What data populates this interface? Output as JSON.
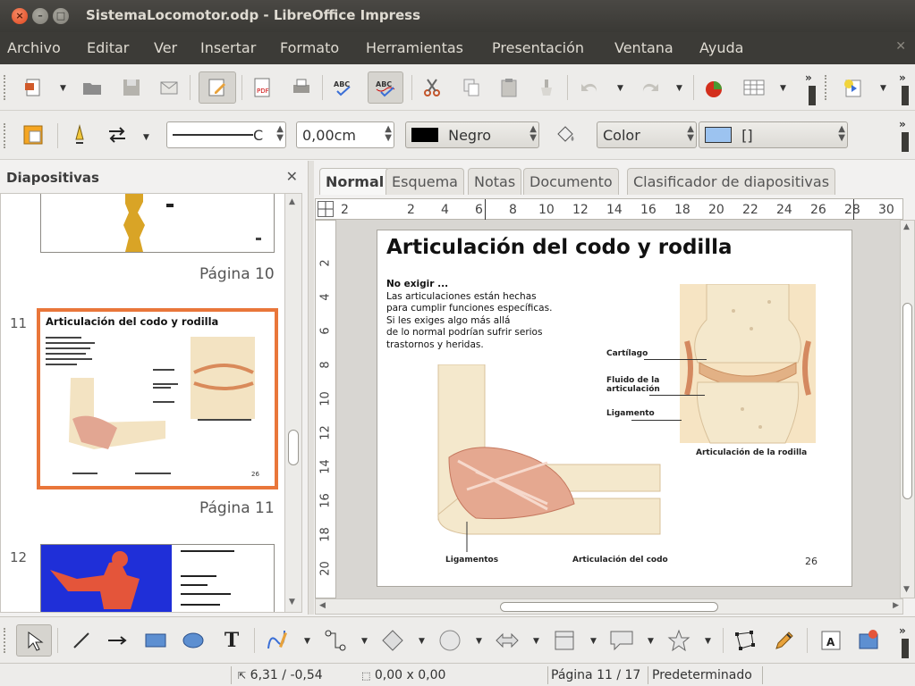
{
  "window": {
    "title": "SistemaLocomotor.odp - LibreOffice Impress"
  },
  "menu": [
    "Archivo",
    "Editar",
    "Ver",
    "Insertar",
    "Formato",
    "Herramientas",
    "Presentación",
    "Ventana",
    "Ayuda"
  ],
  "toolbar2": {
    "line_width": "0,00cm",
    "line_color": "Negro",
    "area_style": "Color",
    "area_color": "[]",
    "line_style_value": "C"
  },
  "slides_panel": {
    "title": "Diapositivas",
    "page10": "Página 10",
    "page11": "Página 11",
    "num11": "11",
    "num12": "12",
    "thumb11_title": "Articulación del codo y rodilla",
    "thumb11_page": "26"
  },
  "tabs": [
    "Normal",
    "Esquema",
    "Notas",
    "Documento",
    "Clasificador de diapositivas"
  ],
  "ruler_h": [
    "2",
    "2",
    "4",
    "6",
    "8",
    "10",
    "12",
    "14",
    "16",
    "18",
    "20",
    "22",
    "24",
    "26",
    "28",
    "30"
  ],
  "ruler_v": [
    "2",
    "4",
    "6",
    "8",
    "10",
    "12",
    "14",
    "16",
    "18",
    "20"
  ],
  "slide": {
    "title": "Articulación del codo y rodilla",
    "text_heading": "No exigir ...",
    "text_lines": [
      "Las articulaciones están hechas",
      "para cumplir funciones específicas.",
      "Si les exiges algo más allá",
      "de lo normal podrían sufrir serios",
      "trastornos y heridas."
    ],
    "label_cartilago": "Cartílago",
    "label_fluido": "Fluido de la articulación",
    "label_ligamento": "Ligamento",
    "label_rodilla": "Articulación de la rodilla",
    "label_ligamentos": "Ligamentos",
    "label_codo": "Articulación del codo",
    "page_number": "26"
  },
  "status": {
    "position": "6,31 / -0,54",
    "size": "0,00 x 0,00",
    "page": "Página 11 / 17",
    "layout": "Predeterminado"
  },
  "colors": {
    "accent_orange": "#e9763a",
    "titlebar": "#3c3b37",
    "close_btn": "#e0461d"
  }
}
